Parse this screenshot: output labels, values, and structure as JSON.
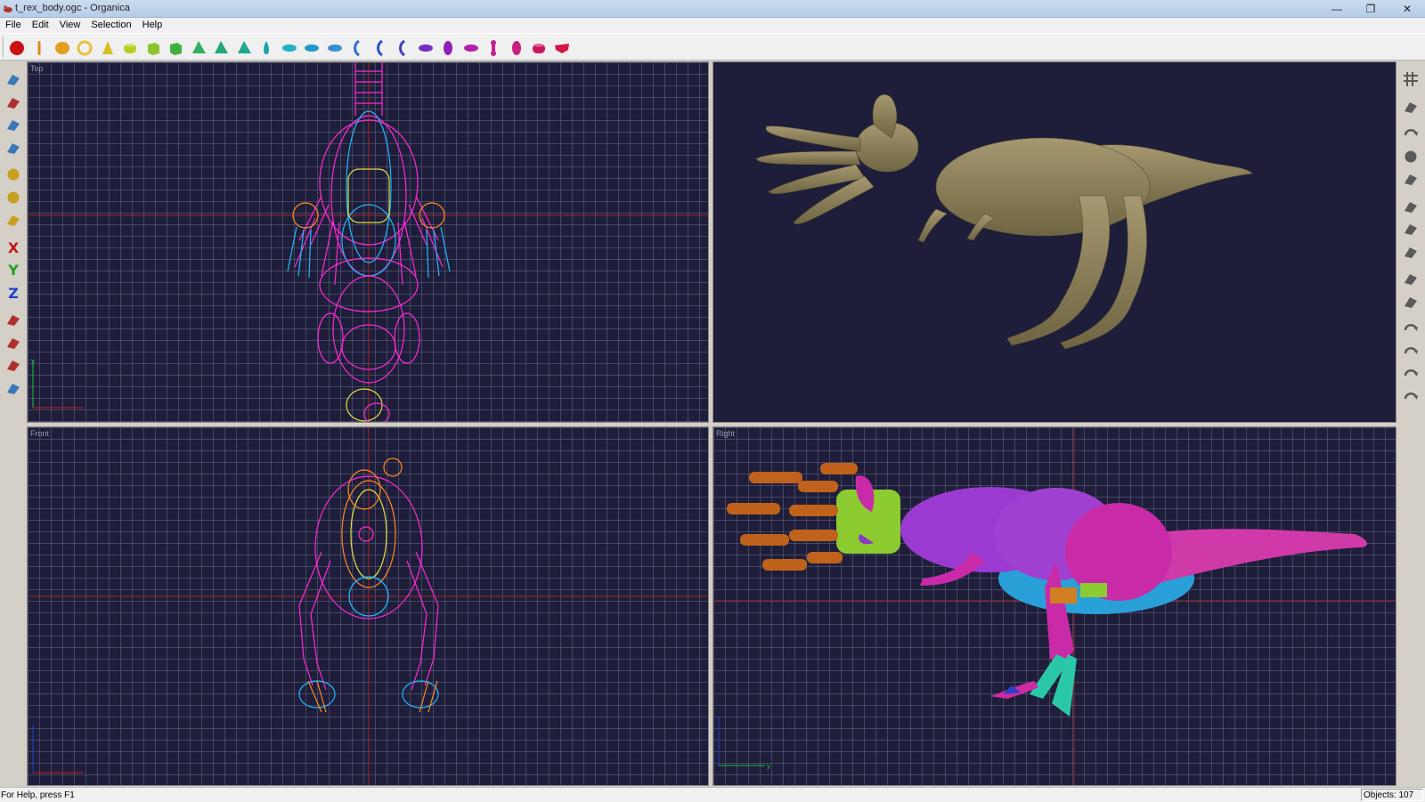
{
  "window": {
    "title": "t_rex_body.ogc - Organica",
    "minimize_glyph": "—",
    "maximize_glyph": "❐",
    "close_glyph": "✕"
  },
  "menu": [
    "File",
    "Edit",
    "View",
    "Selection",
    "Help"
  ],
  "toolbar": {
    "primitives": [
      {
        "icon": "sphere-red-icon",
        "color": "#cc1111"
      },
      {
        "icon": "stick-icon",
        "color": "#d98a1f"
      },
      {
        "icon": "ellipsoid-icon",
        "color": "#e0a020"
      },
      {
        "icon": "ring-icon",
        "color": "#e8c040"
      },
      {
        "icon": "cone-icon",
        "color": "#d8c020"
      },
      {
        "icon": "cylinder-icon",
        "color": "#b8cc20"
      },
      {
        "icon": "cube-icon",
        "color": "#8cc430"
      },
      {
        "icon": "box-icon",
        "color": "#40b040"
      },
      {
        "icon": "pyramid-icon",
        "color": "#30b060"
      },
      {
        "icon": "prism-icon",
        "color": "#20a878"
      },
      {
        "icon": "wedge-icon",
        "color": "#20a890"
      },
      {
        "icon": "teardrop-icon",
        "color": "#20a0a8"
      },
      {
        "icon": "disc-icon",
        "color": "#20b0c8"
      },
      {
        "icon": "lens-icon",
        "color": "#2098c8"
      },
      {
        "icon": "flat-disc-icon",
        "color": "#3890d0"
      },
      {
        "icon": "arc-icon",
        "color": "#3070d0"
      },
      {
        "icon": "crescent-icon",
        "color": "#3050c8"
      },
      {
        "icon": "moon-icon",
        "color": "#4040c0"
      },
      {
        "icon": "saucer-icon",
        "color": "#7030c0"
      },
      {
        "icon": "egg-icon",
        "color": "#9020b8"
      },
      {
        "icon": "oval-icon",
        "color": "#b020a8"
      },
      {
        "icon": "bone-icon",
        "color": "#c02090"
      },
      {
        "icon": "capsule-icon",
        "color": "#c82080"
      },
      {
        "icon": "drum-icon",
        "color": "#c81860"
      },
      {
        "icon": "slab-icon",
        "color": "#d01848"
      }
    ]
  },
  "left_tools": [
    "select-arrow-icon",
    "cut-icon",
    "eyes-icon",
    "paint-icon",
    "sphere-gold-icon",
    "sphere-pair-icon",
    "drop-icon",
    "axis-x-icon",
    "axis-y-icon",
    "axis-z-icon",
    "link-icon",
    "group-icon",
    "ungroup-icon",
    "wrench-icon"
  ],
  "right_tools": [
    "grid-icon",
    "render-icon",
    "rotate-icon",
    "blob-icon",
    "box-tool-icon",
    "bend-icon",
    "twist-icon",
    "skeleton-icon",
    "joint-icon",
    "nodes-icon",
    "undo-icon",
    "redo-icon",
    "orbit-icon",
    "orbit-alt-icon"
  ],
  "viewports": {
    "top": {
      "label": "Top",
      "axis_v": "y"
    },
    "perspective": {
      "label": ""
    },
    "front": {
      "label": "Front"
    },
    "right": {
      "label": "Right",
      "axis_h": "y"
    }
  },
  "colors": {
    "viewport_bg": "#1e1e3a",
    "wire_magenta": "#ff2ad4",
    "wire_cyan": "#22b8ff",
    "wire_orange": "#ff8a20",
    "solid_tan": "#8a7d55",
    "hand_orange": "#c0621c",
    "body_purple": "#9a3ad0",
    "leg_magenta": "#c82aa8",
    "belly_blue": "#2aa0d8",
    "green_block": "#8ccc30",
    "claw_teal": "#2ac8a8"
  },
  "status": {
    "help": "For Help, press F1",
    "objects": "Objects: 107"
  }
}
